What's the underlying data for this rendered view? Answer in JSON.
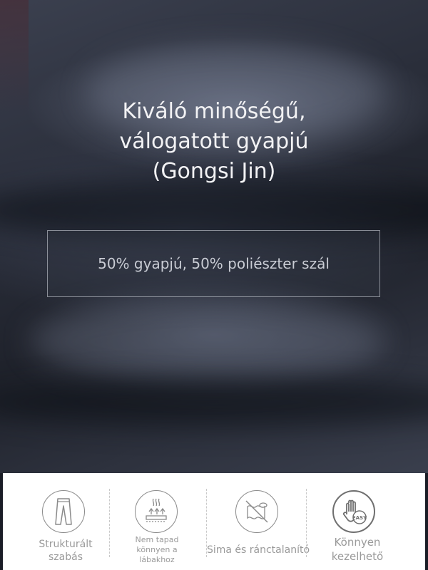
{
  "hero": {
    "title_lines": [
      "Kiváló minőségű,",
      "válogatott gyapjú",
      "(Gongsi Jin)"
    ],
    "composition": "50% gyapjú, 50% poliészter szál"
  },
  "features": [
    {
      "icon": "trousers-icon",
      "label_lines": [
        "Strukturált",
        "szabás"
      ]
    },
    {
      "icon": "anti-static-fabric-icon",
      "label_lines": [
        "Nem tapad",
        "könnyen a",
        "lábakhoz"
      ]
    },
    {
      "icon": "no-wrinkle-icon",
      "label_lines": [
        "Sima és ránctalanító"
      ]
    },
    {
      "icon": "easy-care-hand-icon",
      "label_lines": [
        "Könnyen",
        "kezelhető"
      ],
      "badge": "EASY"
    }
  ]
}
